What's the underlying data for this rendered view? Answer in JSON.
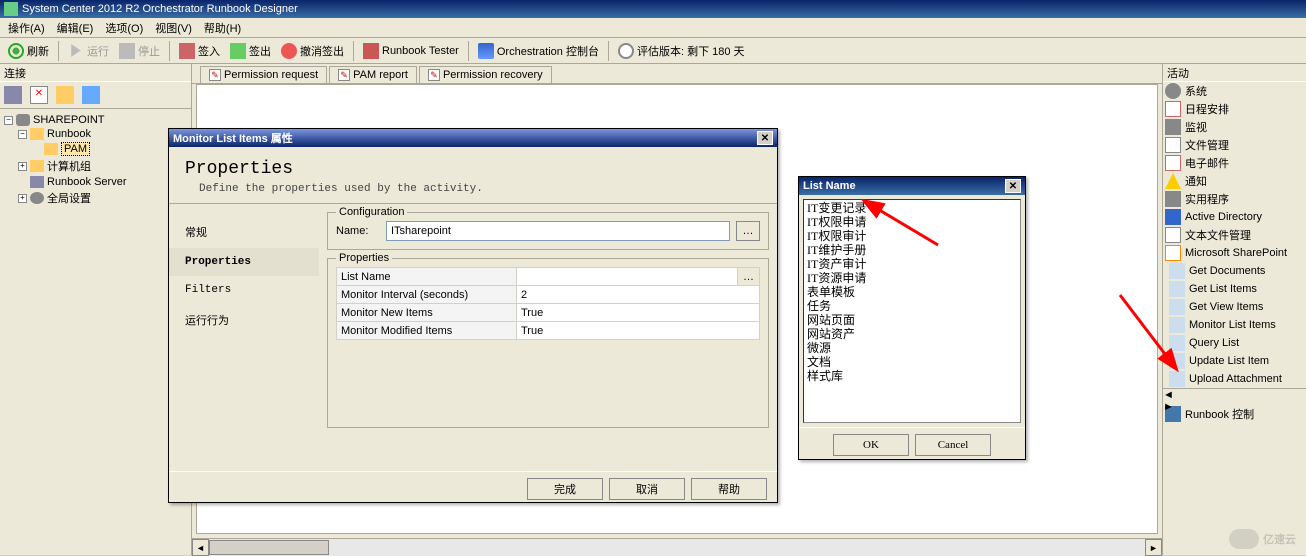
{
  "window": {
    "title": "System Center 2012 R2 Orchestrator Runbook Designer"
  },
  "menubar": [
    "操作(A)",
    "编辑(E)",
    "选项(O)",
    "视图(V)",
    "帮助(H)"
  ],
  "toolbar": {
    "refresh": "刷新",
    "run": "运行",
    "stop": "停止",
    "checkin": "签入",
    "checkout": "签出",
    "undo_checkout": "撤消签出",
    "runbook_tester": "Runbook Tester",
    "orch_console": "Orchestration 控制台",
    "eval": "评估版本: 剩下 180 天"
  },
  "left": {
    "header": "连接",
    "tree": {
      "root": "SHAREPOINT",
      "runbook": "Runbook",
      "pam": "PAM",
      "computer_group": "计算机组",
      "runbook_server": "Runbook Server",
      "global_settings": "全局设置"
    }
  },
  "tabs": [
    "Permission request",
    "PAM report",
    "Permission recovery"
  ],
  "prop_dialog": {
    "title": "Monitor List Items 属性",
    "heading": "Properties",
    "subheading": "Define the properties used by the activity.",
    "nav": {
      "general": "常规",
      "properties": "Properties",
      "filters": "Filters",
      "run_behavior": "运行行为"
    },
    "config": {
      "legend": "Configuration",
      "name_label": "Name:",
      "name_value": "ITsharepoint"
    },
    "props": {
      "legend": "Properties",
      "rows": [
        {
          "k": "List Name",
          "v": ""
        },
        {
          "k": "Monitor Interval (seconds)",
          "v": "2"
        },
        {
          "k": "Monitor New Items",
          "v": "True"
        },
        {
          "k": "Monitor Modified Items",
          "v": "True"
        }
      ]
    },
    "buttons": {
      "finish": "完成",
      "cancel": "取消",
      "help": "帮助"
    }
  },
  "list_dialog": {
    "title": "List Name",
    "options": [
      "IT变更记录",
      "IT权限申请",
      "IT权限审计",
      "IT维护手册",
      "IT资产审计",
      "IT资源申请",
      "表单模板",
      "任务",
      "网站页面",
      "网站资产",
      "微源",
      "文档",
      "样式库"
    ],
    "ok": "OK",
    "cancel": "Cancel"
  },
  "activities": {
    "header": "活动",
    "categories": [
      {
        "icon": "ic-gear",
        "label": "系统"
      },
      {
        "icon": "ic-cal",
        "label": "日程安排"
      },
      {
        "icon": "ic-mon",
        "label": "监视"
      },
      {
        "icon": "ic-file",
        "label": "文件管理"
      },
      {
        "icon": "ic-mail",
        "label": "电子邮件"
      },
      {
        "icon": "ic-warn",
        "label": "通知"
      },
      {
        "icon": "ic-tool",
        "label": "实用程序"
      },
      {
        "icon": "ic-ad",
        "label": "Active Directory"
      },
      {
        "icon": "ic-txt",
        "label": "文本文件管理"
      },
      {
        "icon": "ic-sp",
        "label": "Microsoft SharePoint"
      }
    ],
    "sp_items": [
      "Get Documents",
      "Get List Items",
      "Get View Items",
      "Monitor List Items",
      "Query List",
      "Update List Item",
      "Upload Attachment"
    ],
    "runbook_control": "Runbook 控制"
  },
  "watermark": "亿速云"
}
